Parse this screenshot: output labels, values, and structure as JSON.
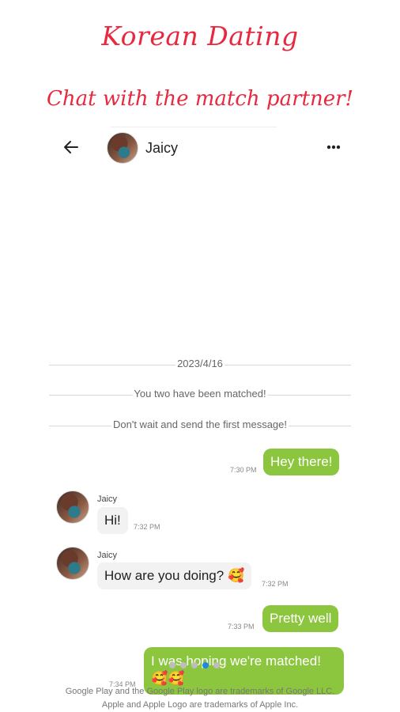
{
  "promo": {
    "title": "Korean Dating",
    "subtitle": "Chat with the match partner!"
  },
  "header": {
    "contact_name": "Jaicy",
    "back_icon": "arrow-left-icon",
    "more_icon": "more-horizontal-icon"
  },
  "chat": {
    "date": "2023/4/16",
    "system_messages": [
      "You two have been matched!",
      "Don't wait and send the first message!"
    ],
    "messages": [
      {
        "direction": "out",
        "text": "Hey there!",
        "time": "7:30 PM"
      },
      {
        "direction": "in",
        "sender": "Jaicy",
        "text": "Hi!",
        "time": "7:32 PM"
      },
      {
        "direction": "in",
        "sender": "Jaicy",
        "text": "How are you doing?",
        "emoji": "🥰",
        "time": "7:32 PM"
      },
      {
        "direction": "out",
        "text": "Pretty well",
        "time": "7:33 PM"
      },
      {
        "direction": "out",
        "text": "I was hoping we're matched!",
        "emoji": "🥰🥰",
        "time": "7:34 PM"
      }
    ]
  },
  "pager": {
    "count": 5,
    "active_index": 3
  },
  "footer": {
    "line1": "Google Play and the Google Play logo are trademarks of Google LLC.",
    "line2": "Apple and Apple Logo are trademarks of Apple Inc."
  },
  "colors": {
    "accent_red": "#e8283f",
    "outgoing_bubble": "#8cc63f",
    "incoming_bubble": "#f2f2f2",
    "pager_active": "#1e88e5"
  }
}
